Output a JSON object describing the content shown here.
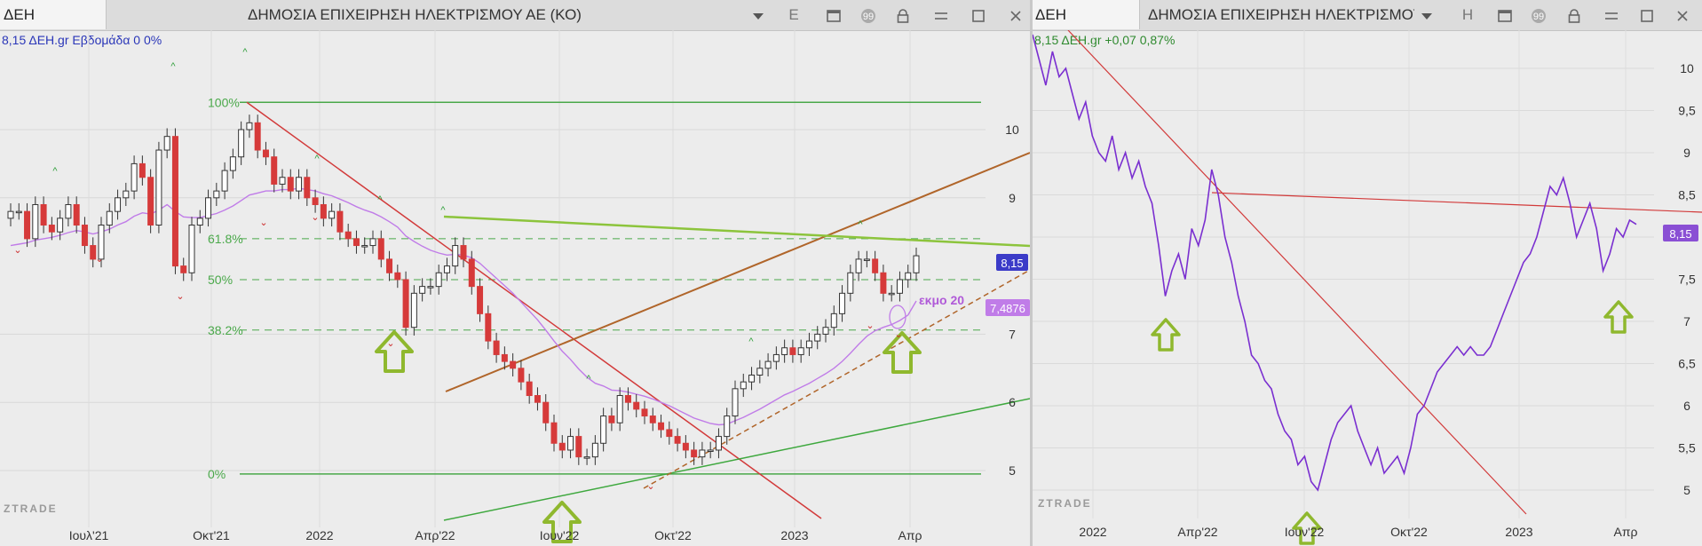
{
  "left_window": {
    "symbol": "ΔΕΗ",
    "title": "ΔΗΜΟΣΙΑ ΕΠΙΧΕΙΡΗΣΗ ΗΛΕΚΤΡΙΣΜΟΥ ΑΕ (ΚΟ)",
    "period_button": "E",
    "info_line": "8,15 ΔΕΗ.gr Εβδομάδα 0 0%",
    "watermark": "ZTRADE"
  },
  "right_window": {
    "symbol": "ΔΕΗ",
    "title": "ΔΗΜΟΣΙΑ ΕΠΙΧΕΙΡΗΣΗ ΗΛΕΚΤΡΙΣΜΟΥ ΑΕ",
    "period_button": "H",
    "info_line": "8,15 ΔΕΗ.gr +0,07 0,87%",
    "watermark": "ZTRADE"
  },
  "colors": {
    "up_candle": "#ffffff",
    "down_candle": "#d63a3a",
    "ema": "#c07ce8",
    "fib_line": "#4aa84a",
    "downtrend": "#d23a3a",
    "channel": "#b0652a",
    "resistance": "#8cc43c",
    "support": "#3ea83e",
    "arrow": "#8fb82e",
    "price_line": "#7a2fd0",
    "last_price_badge": "#3b3bc8",
    "ema_badge": "#c07ce8"
  },
  "chart_data": [
    {
      "type": "candlestick",
      "title": "ΔΗΜΟΣΙΑ ΕΠΙΧΕΙΡΗΣΗ ΗΛΕΚΤΡΙΣΜΟΥ ΑΕ (ΚΟ)",
      "xlabel": "",
      "ylabel": "",
      "x_ticks": [
        "Ιουλ'21",
        "Οκτ'21",
        "2022",
        "Απρ'22",
        "Ιουν'22",
        "Οκτ'22",
        "2023",
        "Απρ"
      ],
      "y_ticks": [
        10,
        9,
        7,
        6,
        5
      ],
      "ylim": [
        4.7,
        10.6
      ],
      "last_price_label": "8,15",
      "ema_label": "εκμο 20",
      "ema_value_label": "7,4876",
      "fib_levels": [
        {
          "label": "100%",
          "value": 10.4
        },
        {
          "label": "61.8%",
          "value": 8.4
        },
        {
          "label": "50%",
          "value": 7.8
        },
        {
          "label": "38.2%",
          "value": 7.06
        },
        {
          "label": "0%",
          "value": 4.95
        }
      ],
      "close": [
        8.8,
        8.8,
        8.4,
        8.9,
        8.6,
        8.5,
        8.7,
        8.9,
        8.6,
        8.3,
        8.1,
        8.6,
        8.8,
        9.0,
        9.1,
        9.5,
        9.3,
        8.6,
        9.7,
        9.9,
        8.0,
        7.9,
        8.6,
        8.7,
        9.0,
        9.1,
        9.4,
        9.6,
        10.0,
        10.1,
        9.7,
        9.6,
        9.2,
        9.3,
        9.1,
        9.3,
        9.0,
        8.9,
        8.7,
        8.8,
        8.5,
        8.4,
        8.3,
        8.3,
        8.4,
        8.1,
        7.9,
        7.8,
        7.1,
        7.6,
        7.7,
        7.7,
        7.9,
        8.0,
        8.3,
        8.1,
        7.7,
        7.3,
        6.9,
        6.7,
        6.6,
        6.5,
        6.3,
        6.1,
        6.0,
        5.7,
        5.4,
        5.3,
        5.5,
        5.2,
        5.2,
        5.4,
        5.8,
        5.7,
        6.1,
        6.0,
        5.9,
        5.8,
        5.7,
        5.6,
        5.5,
        5.4,
        5.3,
        5.2,
        5.3,
        5.3,
        5.5,
        5.8,
        6.2,
        6.3,
        6.4,
        6.5,
        6.6,
        6.7,
        6.8,
        6.7,
        6.8,
        6.9,
        7.0,
        7.1,
        7.3,
        7.6,
        7.9,
        8.1,
        8.1,
        7.9,
        7.6,
        7.6,
        7.8,
        7.9,
        8.15
      ],
      "ema20": [
        8.3,
        8.32,
        8.34,
        8.38,
        8.4,
        8.42,
        8.45,
        8.49,
        8.52,
        8.5,
        8.47,
        8.5,
        8.54,
        8.6,
        8.65,
        8.73,
        8.78,
        8.76,
        8.82,
        8.9,
        8.8,
        8.72,
        8.71,
        8.71,
        8.74,
        8.77,
        8.82,
        8.88,
        8.96,
        9.04,
        9.07,
        9.1,
        9.1,
        9.12,
        9.12,
        9.14,
        9.12,
        9.1,
        9.06,
        9.03,
        8.98,
        8.93,
        8.87,
        8.82,
        8.78,
        8.72,
        8.65,
        8.57,
        8.44,
        8.36,
        8.29,
        8.23,
        8.19,
        8.16,
        8.17,
        8.16,
        8.12,
        8.04,
        7.93,
        7.82,
        7.71,
        7.6,
        7.47,
        7.34,
        7.21,
        7.06,
        6.9,
        6.75,
        6.63,
        6.49,
        6.37,
        6.28,
        6.24,
        6.18,
        6.17,
        6.15,
        6.12,
        6.09,
        6.05,
        6.0,
        5.95,
        5.89,
        5.83,
        5.77,
        5.73,
        5.69,
        5.67,
        5.68,
        5.73,
        5.78,
        5.84,
        5.9,
        5.97,
        6.04,
        6.11,
        6.16,
        6.22,
        6.28,
        6.35,
        6.42,
        6.5,
        6.6,
        6.72,
        6.85,
        6.97,
        7.05,
        7.1,
        7.14,
        7.2,
        7.28,
        7.4876
      ]
    },
    {
      "type": "line",
      "title": "ΔΗΜΟΣΙΑ ΕΠΙΧΕΙΡΗΣΗ ΗΛΕΚΤΡΙΣΜΟΥ ΑΕ",
      "xlabel": "",
      "ylabel": "",
      "x_ticks": [
        "2022",
        "Απρ'22",
        "Ιουν'22",
        "Οκτ'22",
        "2023",
        "Απρ"
      ],
      "y_ticks": [
        "10",
        "9,5",
        "9",
        "8,5",
        "8",
        "7,5",
        "7",
        "6,5",
        "6",
        "5,5",
        "5"
      ],
      "ylim": [
        4.9,
        10.6
      ],
      "last_price_label": "8,15",
      "series": [
        {
          "values": [
            10.4,
            10.1,
            9.8,
            10.2,
            9.9,
            10.0,
            9.7,
            9.4,
            9.6,
            9.2,
            9.0,
            8.9,
            9.2,
            8.8,
            9.0,
            8.7,
            8.9,
            8.6,
            8.4,
            7.9,
            7.3,
            7.6,
            7.8,
            7.5,
            8.1,
            7.9,
            8.2,
            8.8,
            8.5,
            8.0,
            7.7,
            7.3,
            7.0,
            6.6,
            6.5,
            6.3,
            6.2,
            5.9,
            5.7,
            5.6,
            5.3,
            5.4,
            5.1,
            5.0,
            5.3,
            5.6,
            5.8,
            5.9,
            6.0,
            5.7,
            5.5,
            5.3,
            5.5,
            5.2,
            5.3,
            5.4,
            5.2,
            5.5,
            5.9,
            6.0,
            6.2,
            6.4,
            6.5,
            6.6,
            6.7,
            6.6,
            6.7,
            6.6,
            6.6,
            6.7,
            6.9,
            7.1,
            7.3,
            7.5,
            7.7,
            7.8,
            8.0,
            8.3,
            8.6,
            8.5,
            8.7,
            8.4,
            8.0,
            8.2,
            8.4,
            8.1,
            7.6,
            7.8,
            8.1,
            8.0,
            8.2,
            8.15
          ]
        }
      ]
    }
  ]
}
